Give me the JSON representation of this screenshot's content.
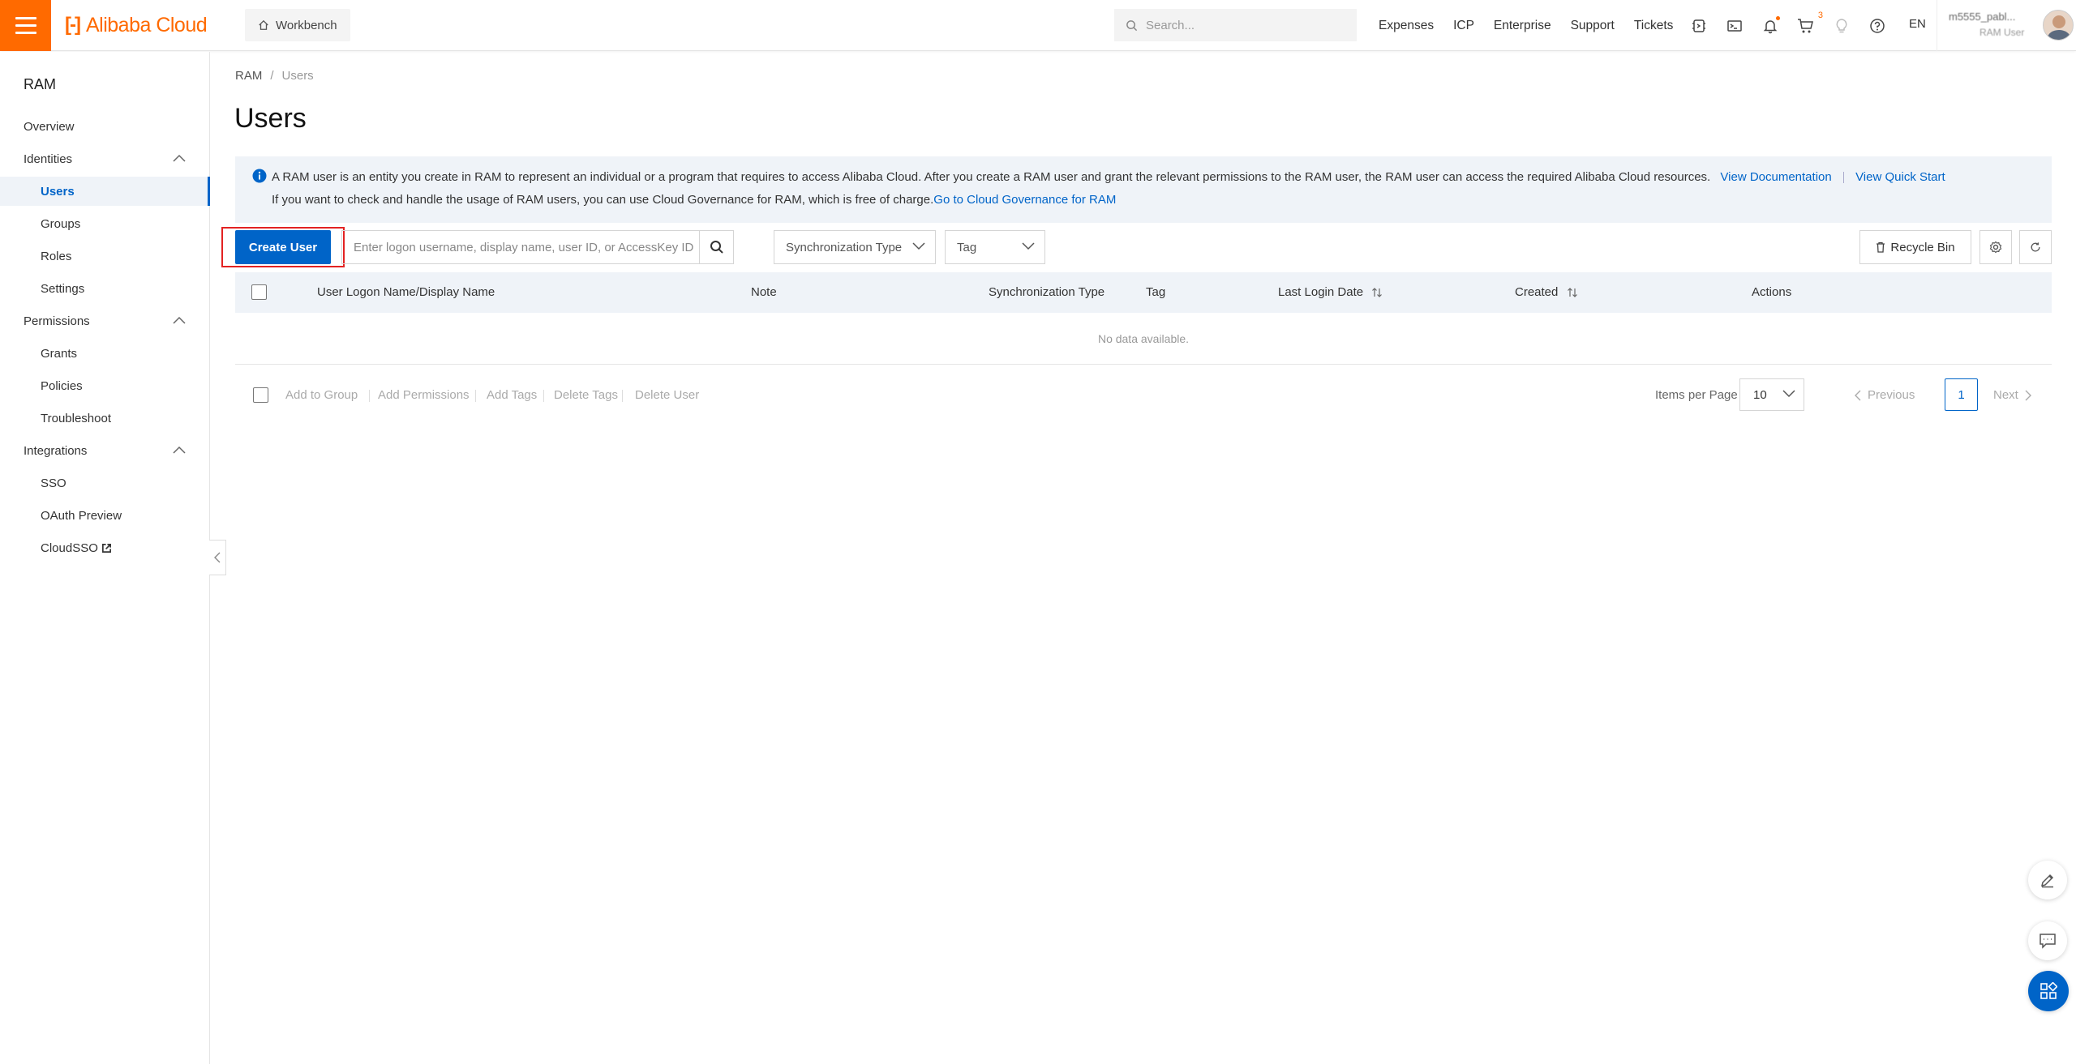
{
  "topbar": {
    "logo_text": "Alibaba Cloud",
    "logo_mark": "[-]",
    "workbench_label": "Workbench",
    "search_placeholder": "Search...",
    "links": [
      "Expenses",
      "ICP",
      "Enterprise",
      "Support",
      "Tickets"
    ],
    "cart_count": "3",
    "lang": "EN",
    "user_name": "m5555_pabl...",
    "user_role": "RAM User",
    "accent": "#ff6a00"
  },
  "sidebar": {
    "title": "RAM",
    "overview": "Overview",
    "identities": "Identities",
    "users": "Users",
    "groups": "Groups",
    "roles": "Roles",
    "settings": "Settings",
    "permissions": "Permissions",
    "grants": "Grants",
    "policies": "Policies",
    "troubleshoot": "Troubleshoot",
    "integrations": "Integrations",
    "sso": "SSO",
    "oauth": "OAuth Preview",
    "cloudsso": "CloudSSO"
  },
  "main": {
    "breadcrumb": {
      "root": "RAM",
      "sep": "/",
      "current": "Users"
    },
    "title": "Users",
    "notice": {
      "line1": "A RAM user is an entity you create in RAM to represent an individual or a program that requires to access Alibaba Cloud. After you create a RAM user and grant the relevant permissions to the RAM user, the RAM user can access the required Alibaba Cloud resources.",
      "view_docs": "View Documentation",
      "quick_start": "View Quick Start",
      "line2": "If you want to check and handle the usage of RAM users, you can use Cloud Governance for RAM, which is free of charge.",
      "governance_link": "Go to Cloud Governance for RAM"
    },
    "toolbar": {
      "create_user": "Create User",
      "search_placeholder": "Enter logon username, display name, user ID, or AccessKey ID",
      "sync_type": "Synchronization Type",
      "tag": "Tag",
      "recycle_bin": "Recycle Bin"
    },
    "table": {
      "columns": [
        "User Logon Name/Display Name",
        "Note",
        "Synchronization Type",
        "Tag",
        "Last Login Date",
        "Created",
        "Actions"
      ],
      "empty": "No data available."
    },
    "footer": {
      "batch_actions": [
        "Add to Group",
        "Add Permissions",
        "Add Tags",
        "Delete Tags",
        "Delete User"
      ],
      "items_per_page_label": "Items per Page",
      "items_per_page": "10",
      "previous": "Previous",
      "page": "1",
      "next": "Next"
    }
  },
  "colors": {
    "primary": "#0064c8",
    "highlight": "#e32222"
  }
}
